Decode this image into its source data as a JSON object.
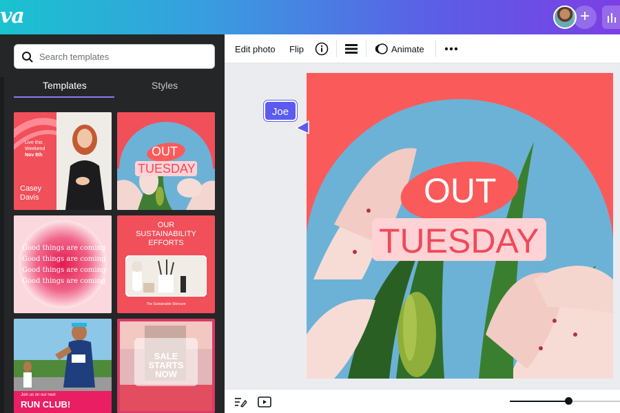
{
  "app": {
    "logo_text": "va"
  },
  "topbar": {
    "plus_symbol": "+",
    "avatar_name": "user-avatar"
  },
  "sidepanel": {
    "search_placeholder": "Search templates",
    "tabs": [
      {
        "label": "Templates",
        "active": true
      },
      {
        "label": "Styles",
        "active": false
      }
    ],
    "templates": [
      {
        "lines": [
          "Live this",
          "Weekend",
          "Nov 8th"
        ],
        "name_lines": [
          "Casey",
          "Davis"
        ]
      },
      {
        "line1": "OUT",
        "line2": "TUESDAY"
      },
      {
        "lines": [
          "Good things are coming",
          "Good things are coming",
          "Good things are coming",
          "Good things are coming"
        ]
      },
      {
        "title_lines": [
          "OUR",
          "SUSTAINABILITY",
          "EFFORTS"
        ],
        "footer": "The Sustainable Skincare"
      },
      {
        "small": "Join us on our next",
        "title": "RUN CLUB!"
      },
      {
        "lines": [
          "SALE",
          "STARTS",
          "NOW"
        ]
      }
    ]
  },
  "toolbar": {
    "edit_photo": "Edit photo",
    "flip": "Flip",
    "animate": "Animate"
  },
  "canvas": {
    "headline_top": "OUT",
    "headline_bottom": "TUESDAY",
    "collaborator": "Joe"
  },
  "colors": {
    "brand_gradient_start": "#19c3cf",
    "brand_gradient_end": "#7b3fe4",
    "artboard_red": "#fb5a5a",
    "sky_blue": "#6cb2d6",
    "pill_pink": "#ffd2d6",
    "collaborator_blue": "#5b5bf0"
  }
}
